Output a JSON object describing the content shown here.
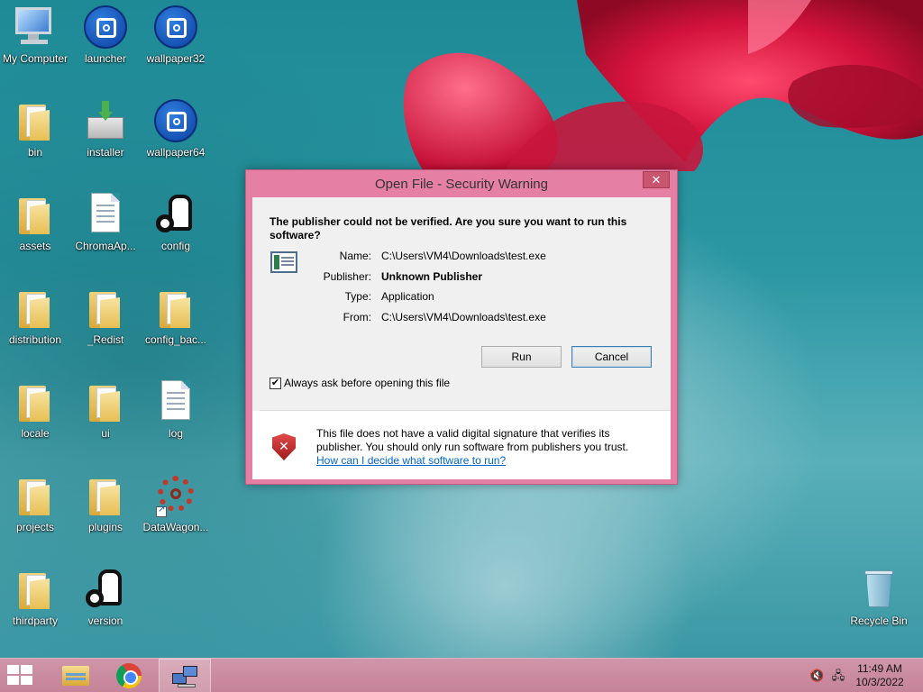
{
  "desktop": {
    "icons": [
      {
        "label": "My Computer"
      },
      {
        "label": "launcher"
      },
      {
        "label": "wallpaper32"
      },
      {
        "label": "bin"
      },
      {
        "label": "installer"
      },
      {
        "label": "wallpaper64"
      },
      {
        "label": "assets"
      },
      {
        "label": "ChromaAp..."
      },
      {
        "label": "config"
      },
      {
        "label": "distribution"
      },
      {
        "label": "_Redist"
      },
      {
        "label": "config_bac..."
      },
      {
        "label": "locale"
      },
      {
        "label": "ui"
      },
      {
        "label": "log"
      },
      {
        "label": "projects"
      },
      {
        "label": "plugins"
      },
      {
        "label": "DataWagon..."
      },
      {
        "label": "thirdparty"
      },
      {
        "label": "version"
      },
      {
        "label": "Recycle Bin"
      }
    ]
  },
  "dialog": {
    "title": "Open File - Security Warning",
    "close_glyph": "✕",
    "heading": "The publisher could not be verified.  Are you sure you want to run this software?",
    "props": [
      {
        "key": "Name:",
        "value": "C:\\Users\\VM4\\Downloads\\test.exe"
      },
      {
        "key": "Publisher:",
        "value": "Unknown Publisher"
      },
      {
        "key": "Type:",
        "value": "Application"
      },
      {
        "key": "From:",
        "value": "C:\\Users\\VM4\\Downloads\\test.exe"
      }
    ],
    "run_label": "Run",
    "cancel_label": "Cancel",
    "checkbox_label": "Always ask before opening this file",
    "checkbox_checked": true,
    "checkbox_glyph": "✔",
    "warning_text": "This file does not have a valid digital signature that verifies its publisher.  You should only run software from publishers you trust.",
    "help_link": "How can I decide what software to run?",
    "shield_glyph": "✕"
  },
  "taskbar": {
    "tray": {
      "volume_glyph": "🔇",
      "network_glyph": "🖧"
    },
    "clock": {
      "time": "11:49 AM",
      "date": "10/3/2022"
    }
  },
  "colors": {
    "dialog_frame": "#e57fa3",
    "taskbar": "#d98ea4",
    "link": "#0066cc"
  }
}
